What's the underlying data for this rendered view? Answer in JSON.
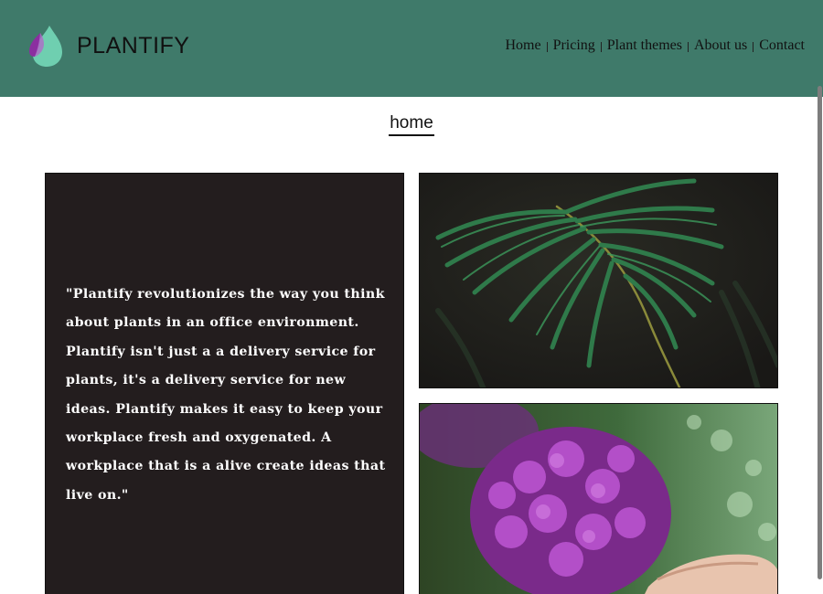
{
  "brand": {
    "name": "PLANTIFY",
    "logo_icon": "leaf-drop-icon"
  },
  "nav": {
    "items": [
      {
        "label": "Home"
      },
      {
        "label": "Pricing"
      },
      {
        "label": "Plant themes"
      },
      {
        "label": "About us"
      },
      {
        "label": "Contact"
      }
    ]
  },
  "page": {
    "title": "home"
  },
  "quote": {
    "text": "\"Plantify revolutionizes the way you think about plants in an office environment. Plantify isn't just a a delivery service for plants, it's a delivery service for new ideas. Plantify makes it easy to keep your workplace fresh and oxygenated. A workplace that is a alive create ideas that live on.\""
  },
  "images": [
    {
      "icon": "palm-leaf-photo"
    },
    {
      "icon": "purple-hydrangea-photo"
    }
  ],
  "colors": {
    "header_bg": "#3f7a6a",
    "quote_bg": "#231d1e",
    "logo_teal": "#6fcfb0",
    "logo_purple": "#8b2fa0"
  }
}
